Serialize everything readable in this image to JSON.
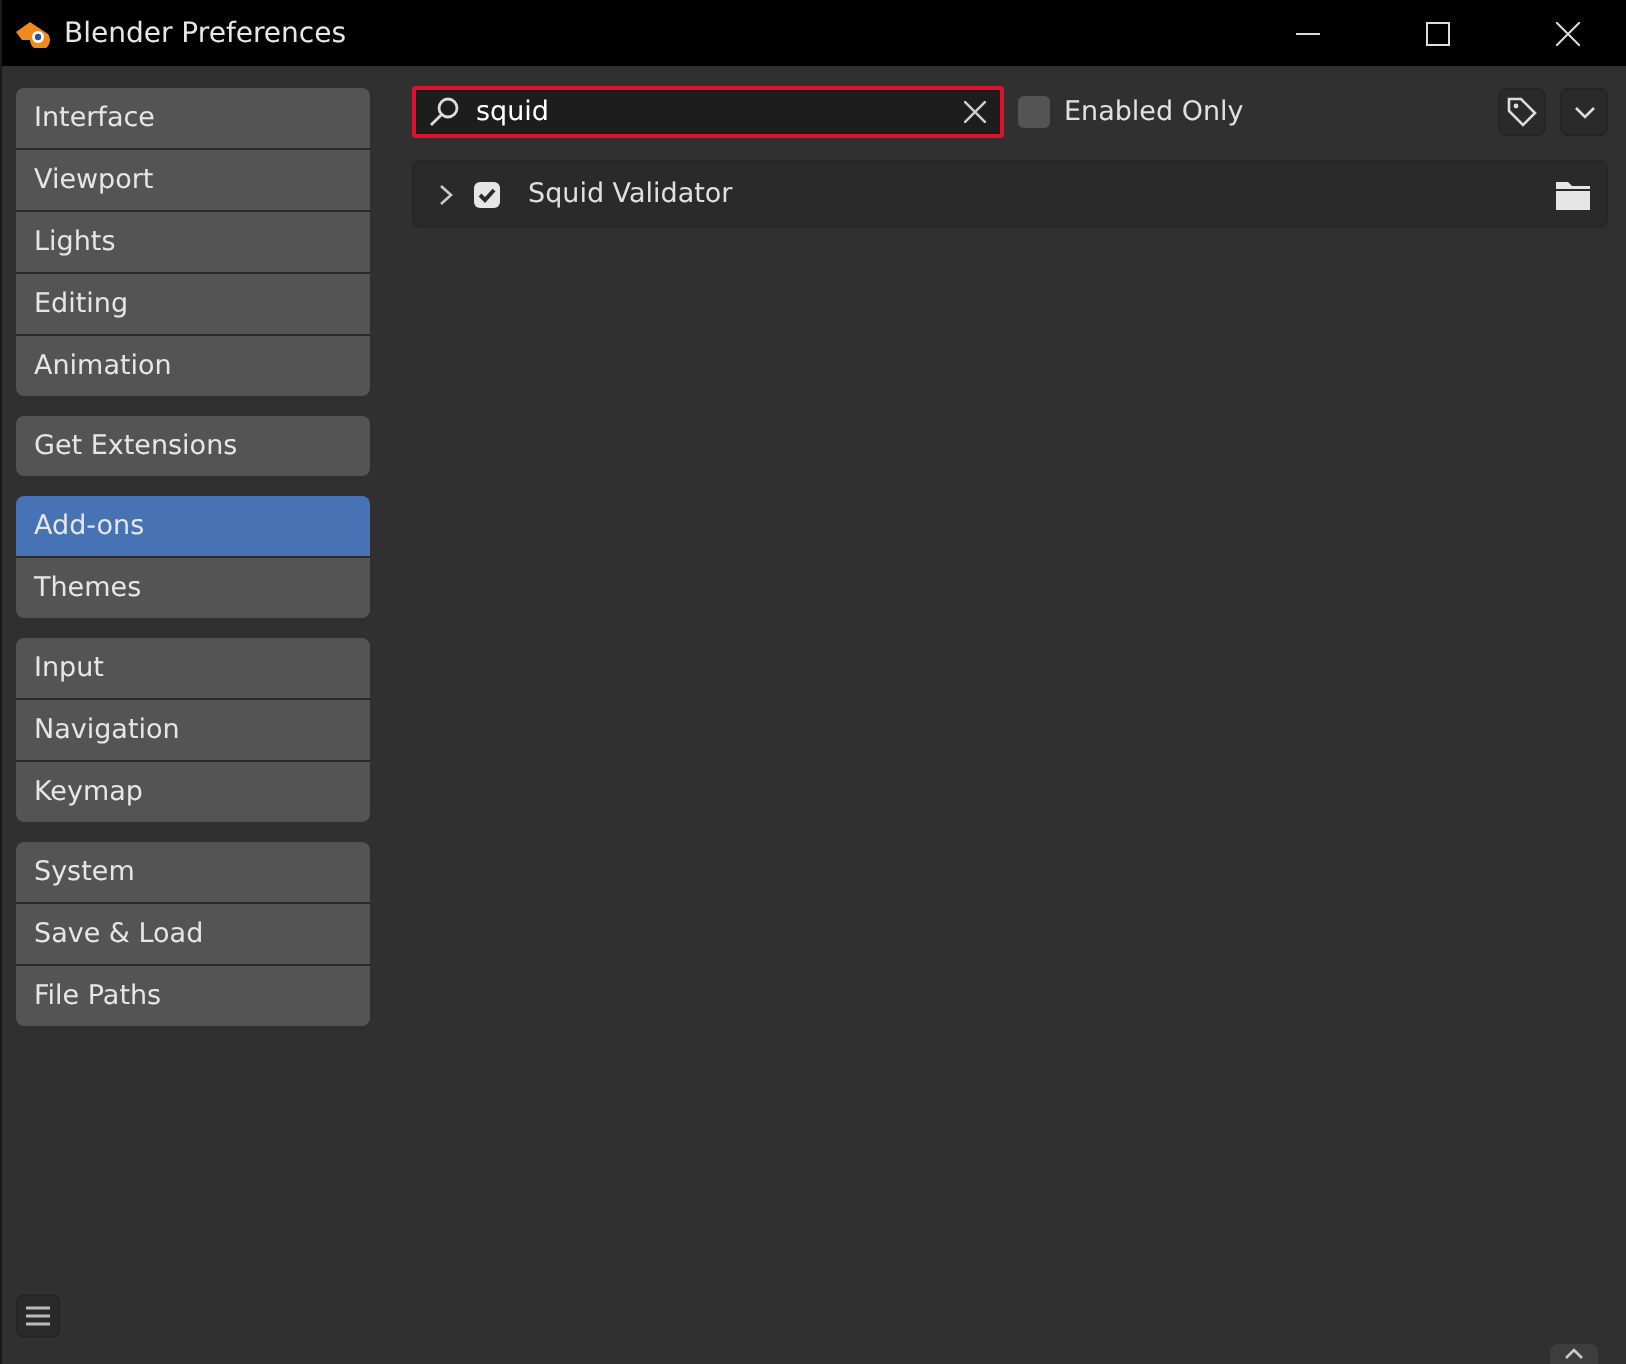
{
  "window": {
    "title": "Blender Preferences"
  },
  "sidebar": {
    "groups": [
      {
        "items": [
          {
            "label": "Interface",
            "selected": false
          },
          {
            "label": "Viewport",
            "selected": false
          },
          {
            "label": "Lights",
            "selected": false
          },
          {
            "label": "Editing",
            "selected": false
          },
          {
            "label": "Animation",
            "selected": false
          }
        ]
      },
      {
        "items": [
          {
            "label": "Get Extensions",
            "selected": false
          }
        ]
      },
      {
        "items": [
          {
            "label": "Add-ons",
            "selected": true
          },
          {
            "label": "Themes",
            "selected": false
          }
        ]
      },
      {
        "items": [
          {
            "label": "Input",
            "selected": false
          },
          {
            "label": "Navigation",
            "selected": false
          },
          {
            "label": "Keymap",
            "selected": false
          }
        ]
      },
      {
        "items": [
          {
            "label": "System",
            "selected": false
          },
          {
            "label": "Save & Load",
            "selected": false
          },
          {
            "label": "File Paths",
            "selected": false
          }
        ]
      }
    ]
  },
  "search": {
    "value": "squid",
    "highlighted": true
  },
  "enabled_only": {
    "label": "Enabled Only",
    "checked": false
  },
  "addons": [
    {
      "name": "Squid Validator",
      "enabled": true,
      "expanded": false
    }
  ]
}
